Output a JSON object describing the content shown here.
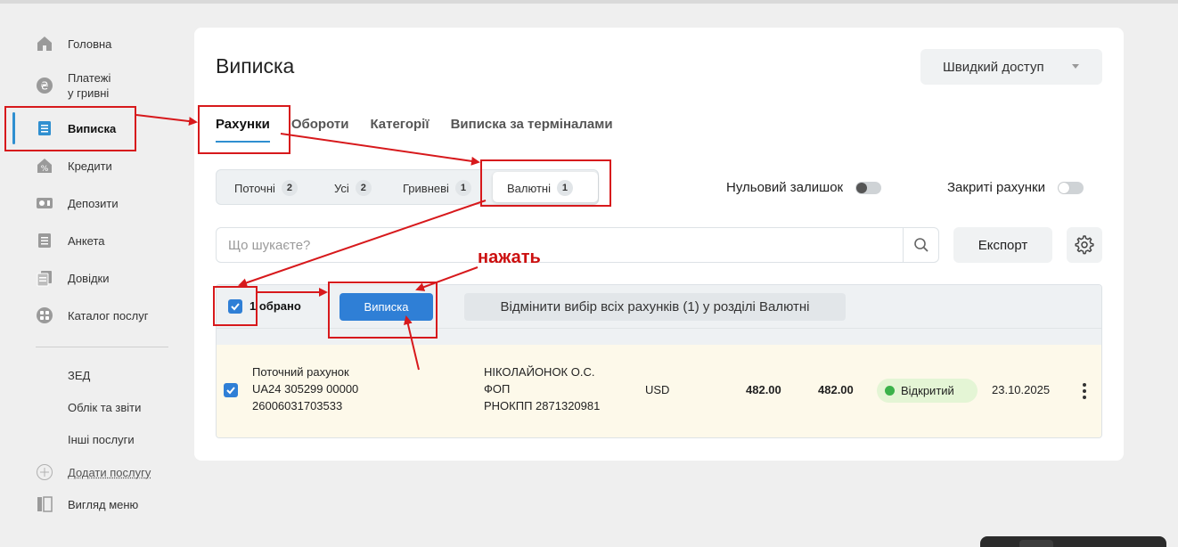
{
  "sidebar": {
    "items": [
      {
        "label": "Головна",
        "icon": "home-icon"
      },
      {
        "label": "Платежі\nу гривні",
        "icon": "hryvnia-icon"
      },
      {
        "label": "Виписка",
        "icon": "statement-icon"
      },
      {
        "label": "Кредити",
        "icon": "credit-icon"
      },
      {
        "label": "Депозити",
        "icon": "deposit-icon"
      },
      {
        "label": "Анкета",
        "icon": "form-icon"
      },
      {
        "label": "Довідки",
        "icon": "documents-icon"
      },
      {
        "label": "Каталог послуг",
        "icon": "catalog-icon"
      }
    ],
    "secondary": [
      "ЗЕД",
      "Облік та звіти",
      "Інші послуги"
    ],
    "add_service": "Додати послугу",
    "menu_view": "Вигляд меню"
  },
  "page": {
    "title": "Виписка",
    "quick_access": "Швидкий доступ"
  },
  "tabs": [
    "Рахунки",
    "Обороти",
    "Категорії",
    "Виписка за терміналами"
  ],
  "segments": [
    {
      "label": "Поточні",
      "count": "2"
    },
    {
      "label": "Усі",
      "count": "2"
    },
    {
      "label": "Гривневі",
      "count": "1"
    },
    {
      "label": "Валютні",
      "count": "1"
    }
  ],
  "toggles": {
    "zero_balance": "Нульовий залишок",
    "closed_accounts": "Закриті рахунки"
  },
  "search": {
    "placeholder": "Що шукаєте?"
  },
  "export_label": "Експорт",
  "table": {
    "selected_count": "1 обрано",
    "statement_button": "Виписка",
    "deselect_button": "Відмінити вибір всіх рахунків (1) у розділі Валютні",
    "row": {
      "account_type": "Поточний рахунок",
      "iban_line1": "UA24 305299 00000",
      "iban_line2": "26006031703533",
      "owner_name": "НІКОЛАЙОНОК О.С.",
      "owner_type": "ФОП",
      "owner_tax": "РНОКПП 2871320981",
      "currency": "USD",
      "balance1": "482.00",
      "balance2": "482.00",
      "status": "Відкритий",
      "date": "23.10.2025"
    }
  },
  "annotation": {
    "text": "нажать",
    "color": "#d7191c"
  },
  "colors": {
    "accent": "#2f7fd6",
    "status_open": "#3bb24a",
    "row_highlight": "#fdf9ea"
  }
}
